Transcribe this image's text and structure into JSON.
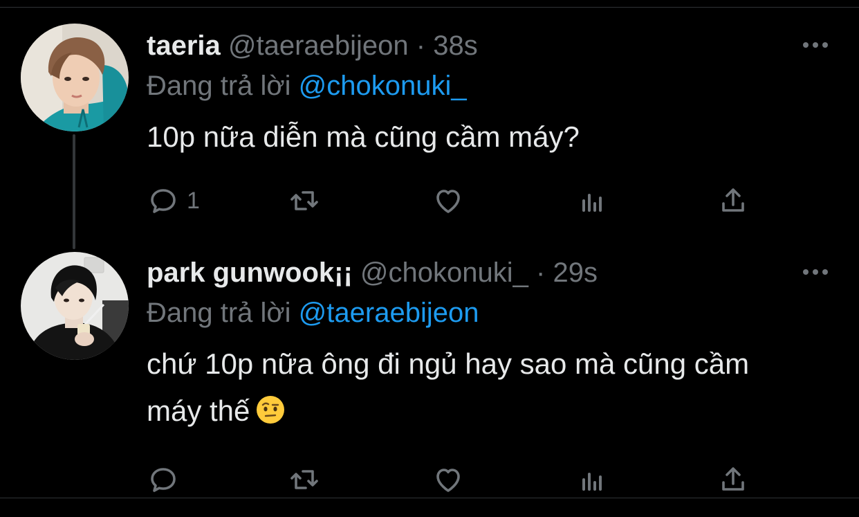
{
  "tweets": [
    {
      "name": "taeria",
      "handle": "@taeraebijeon",
      "dot": "·",
      "time": "38s",
      "replying_prefix": "Đang trả lời",
      "replying_to": "@chokonuki_",
      "text": "10p nữa diễn mà cũng cầm máy?",
      "reply_count": "1"
    },
    {
      "name": "park gunwook¡¡",
      "handle": "@chokonuki_",
      "dot": "·",
      "time": "29s",
      "replying_prefix": "Đang trả lời",
      "replying_to": "@taeraebijeon",
      "text": "chứ 10p nữa ông đi ngủ hay sao mà cũng cầm máy thế",
      "emoji": "face-with-raised-eyebrow",
      "reply_count": ""
    }
  ],
  "icons": {
    "reply": "reply-icon",
    "retweet": "retweet-icon",
    "like": "heart-icon",
    "views": "views-icon",
    "share": "share-icon",
    "more": "more-icon"
  },
  "colors": {
    "background": "#000000",
    "text": "#e7e9ea",
    "secondary": "#71767b",
    "link": "#1d9bf0",
    "divider": "#2f3336"
  }
}
